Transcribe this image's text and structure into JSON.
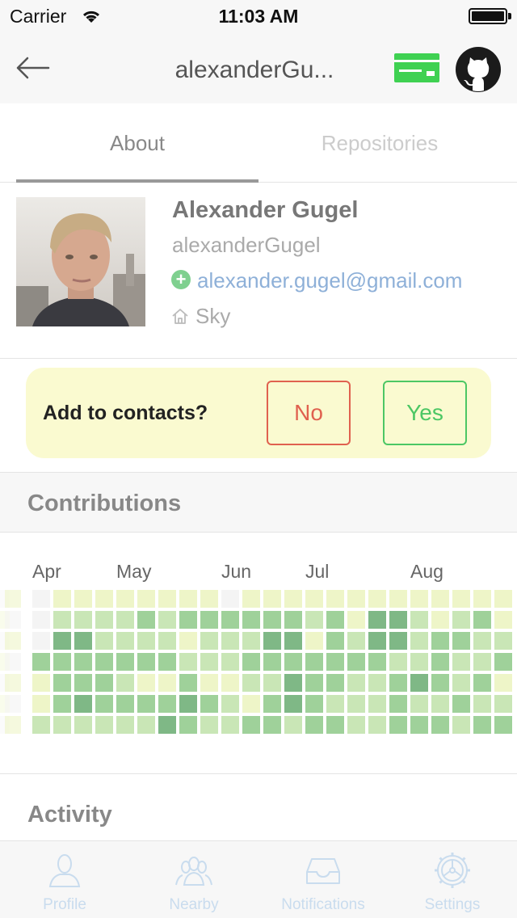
{
  "status_bar": {
    "carrier": "Carrier",
    "time": "11:03 AM"
  },
  "nav": {
    "title": "alexanderGu..."
  },
  "tabs": [
    {
      "label": "About",
      "active": true
    },
    {
      "label": "Repositories",
      "active": false
    }
  ],
  "profile": {
    "name": "Alexander Gugel",
    "login": "alexanderGugel",
    "email": "alexander.gugel@gmail.com",
    "location": "Sky"
  },
  "contacts_prompt": {
    "question": "Add to contacts?",
    "no_label": "No",
    "yes_label": "Yes"
  },
  "contributions": {
    "title": "Contributions",
    "months": [
      "Apr",
      "May",
      "Jun",
      "Jul",
      "Aug"
    ],
    "levels": [
      "011111111011111111111111",
      "022223233333323144212313",
      "044222212224413244233223",
      "333333322233333332232233",
      "133321131122433223432313",
      "134333353213432223223221",
      "2222224322332332233323322"
    ]
  },
  "activity": {
    "title": "Activity"
  },
  "tab_bar": [
    {
      "label": "Profile",
      "icon": "person-icon"
    },
    {
      "label": "Nearby",
      "icon": "people-icon"
    },
    {
      "label": "Notifications",
      "icon": "inbox-icon"
    },
    {
      "label": "Settings",
      "icon": "gear-icon"
    }
  ],
  "colors": {
    "accent_green": "#4cc764",
    "no_red": "#e0614f",
    "link_blue": "#8eb0d8",
    "card_bg": "#fafad0",
    "heat": [
      "#f4f4f4",
      "#eef5c8",
      "#c9e6b6",
      "#9fd19a",
      "#7fb886"
    ]
  }
}
